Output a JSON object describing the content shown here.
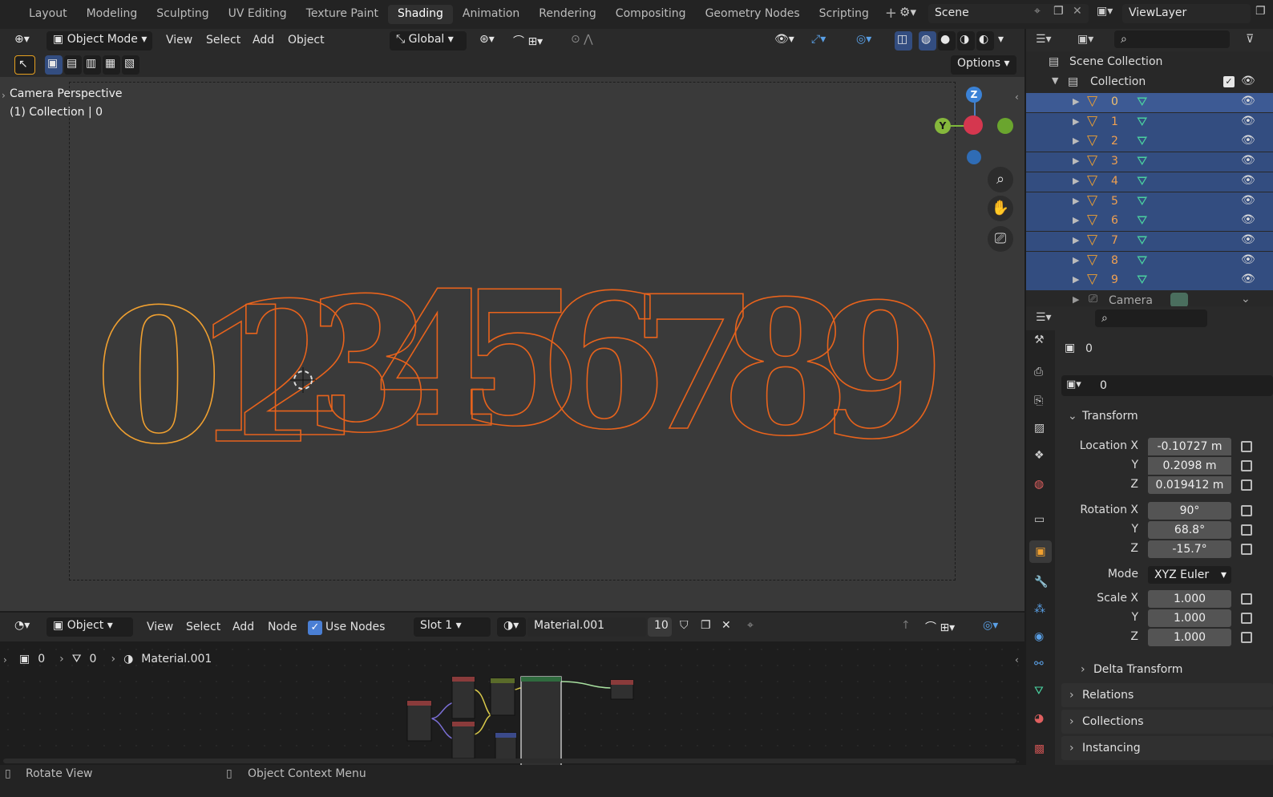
{
  "workspace_tabs": [
    "Layout",
    "Modeling",
    "Sculpting",
    "UV Editing",
    "Texture Paint",
    "Shading",
    "Animation",
    "Rendering",
    "Compositing",
    "Geometry Nodes",
    "Scripting"
  ],
  "active_tab": "Shading",
  "scene": {
    "name": "Scene",
    "view_layer": "ViewLayer"
  },
  "viewport_header": {
    "mode": "Object Mode",
    "menus": [
      "View",
      "Select",
      "Add",
      "Object"
    ],
    "orientation": "Global",
    "options_label": "Options"
  },
  "viewport": {
    "line1": "Camera Perspective",
    "line2": "(1) Collection | 0",
    "gizmo_z": "Z",
    "gizmo_y": "Y",
    "digits": "0123456789"
  },
  "node_header": {
    "type": "Object",
    "menus": [
      "View",
      "Select",
      "Add",
      "Node"
    ],
    "use_nodes": "Use Nodes",
    "slot": "Slot 1",
    "material": "Material.001",
    "users": "10"
  },
  "breadcrumb": {
    "object": "0",
    "mesh": "0",
    "material": "Material.001"
  },
  "outliner": {
    "scene_collection": "Scene Collection",
    "collection": "Collection",
    "items": [
      "0",
      "1",
      "2",
      "3",
      "4",
      "5",
      "6",
      "7",
      "8",
      "9"
    ],
    "camera": "Camera"
  },
  "properties": {
    "object_name": "0",
    "datablock": "0",
    "transform_title": "Transform",
    "location": {
      "label": "Location X",
      "x": "-0.10727 m",
      "y": "0.2098 m",
      "z": "0.019412 m"
    },
    "rotation": {
      "label": "Rotation X",
      "x": "90°",
      "y": "68.8°",
      "z": "-15.7°"
    },
    "mode": {
      "label": "Mode",
      "value": "XYZ Euler"
    },
    "scale": {
      "label": "Scale X",
      "x": "1.000",
      "y": "1.000",
      "z": "1.000"
    },
    "axis_y": "Y",
    "axis_z": "Z",
    "panels": [
      "Delta Transform",
      "Relations",
      "Collections",
      "Instancing"
    ]
  },
  "status": {
    "left": "Rotate View",
    "mid": "Object Context Menu"
  },
  "colors": {
    "accent": "#334d80",
    "wire": "#e8631c",
    "wire_sel": "#f0a030",
    "active_tab": "#303030"
  }
}
